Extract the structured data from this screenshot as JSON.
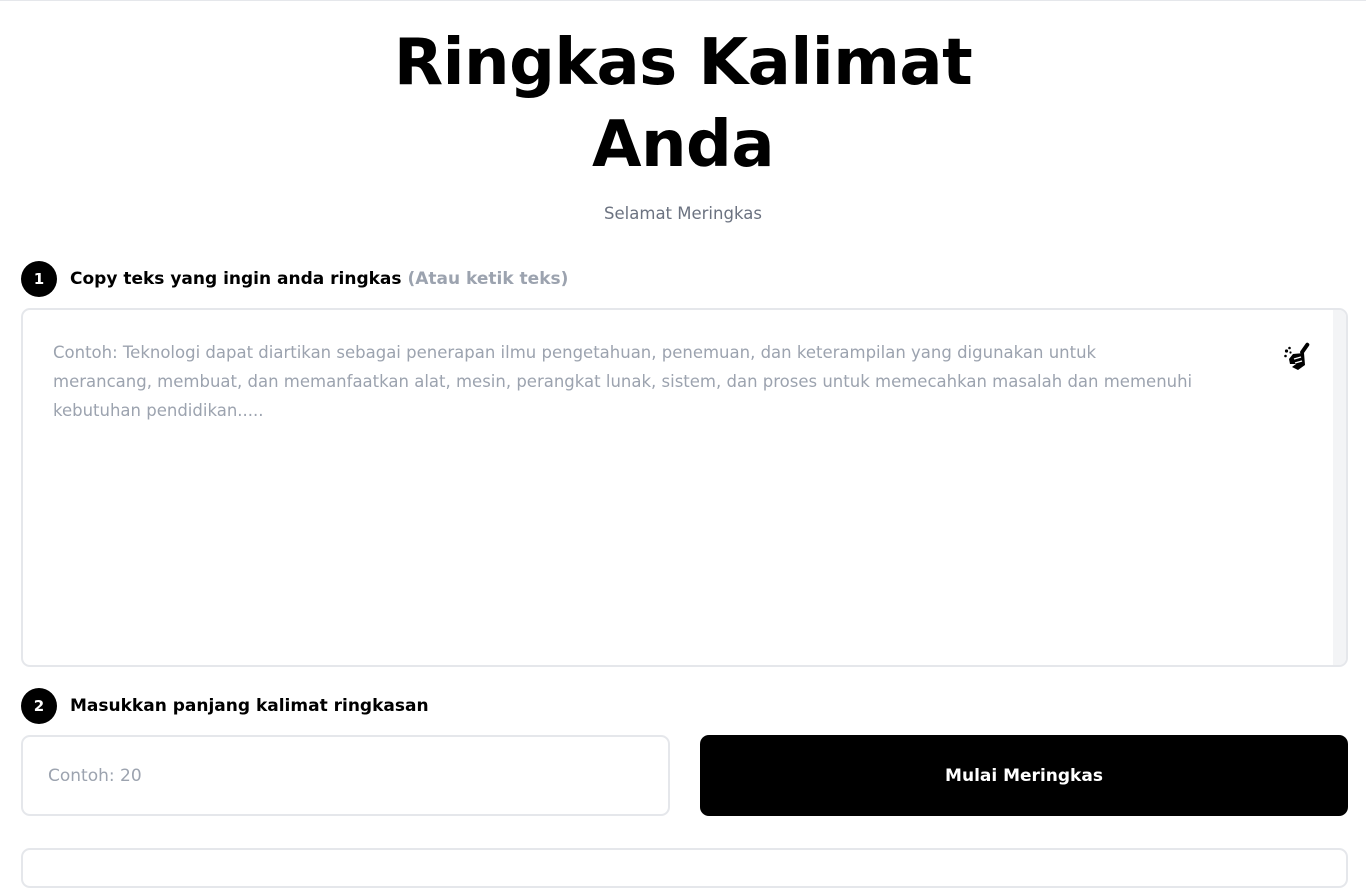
{
  "hero": {
    "title": "Ringkas Kalimat Anda",
    "subtitle": "Selamat Meringkas"
  },
  "step1": {
    "number": "1",
    "label": "Copy teks yang ingin anda ringkas",
    "hint": "(Atau ketik teks)",
    "textarea_placeholder": "Contoh: Teknologi dapat diartikan sebagai penerapan ilmu pengetahuan, penemuan, dan keterampilan yang digunakan untuk merancang, membuat, dan memanfaatkan alat, mesin, perangkat lunak, sistem, dan proses untuk memecahkan masalah dan memenuhi kebutuhan pendidikan.....",
    "textarea_value": "",
    "clear_icon": "broom-icon"
  },
  "step2": {
    "number": "2",
    "label": "Masukkan panjang kalimat ringkasan",
    "input_placeholder": "Contoh: 20",
    "input_value": "",
    "button_label": "Mulai Meringkas"
  },
  "colors": {
    "primary": "#000000",
    "muted_text": "#6b7280",
    "placeholder": "#9ca3af",
    "border": "#e5e7eb"
  }
}
